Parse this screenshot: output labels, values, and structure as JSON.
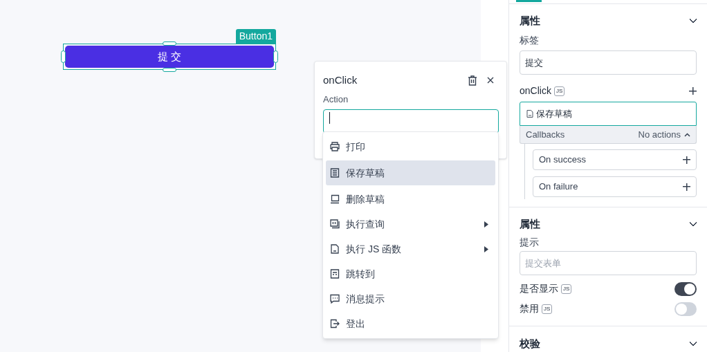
{
  "canvas": {
    "widget_name": "Button1",
    "button_label": "提 交"
  },
  "action_popup": {
    "title": "onClick",
    "action_label": "Action",
    "menu": [
      {
        "label": "打印",
        "kind": "printer",
        "submenu": false,
        "selected": false
      },
      {
        "label": "保存草稿",
        "kind": "document",
        "submenu": false,
        "selected": true
      },
      {
        "label": "删除草稿",
        "kind": "laptop",
        "submenu": false,
        "selected": false
      },
      {
        "label": "执行查询",
        "kind": "query",
        "submenu": true,
        "selected": false
      },
      {
        "label": "执行 JS 函数",
        "kind": "jsfile",
        "submenu": true,
        "selected": false
      },
      {
        "label": "跳转到",
        "kind": "page",
        "submenu": false,
        "selected": false
      },
      {
        "label": "消息提示",
        "kind": "message",
        "submenu": false,
        "selected": false
      },
      {
        "label": "登出",
        "kind": "logout",
        "submenu": false,
        "selected": false
      }
    ]
  },
  "properties_panel": {
    "section_1": {
      "title": "属性",
      "label_field": {
        "label": "标签",
        "value": "提交"
      },
      "onclick": {
        "label": "onClick",
        "badge": "JS",
        "action": "保存草稿",
        "callbacks_label": "Callbacks",
        "callbacks_status": "No actions",
        "callbacks": [
          "On success",
          "On failure"
        ]
      }
    },
    "section_2": {
      "title": "属性",
      "hint_field": {
        "label": "提示",
        "placeholder": "提交表单"
      },
      "toggles": [
        {
          "label": "是否显示",
          "badge": "JS",
          "on": true
        },
        {
          "label": "禁用",
          "badge": "JS",
          "on": false
        }
      ]
    },
    "section_3": {
      "title": "校验"
    }
  }
}
